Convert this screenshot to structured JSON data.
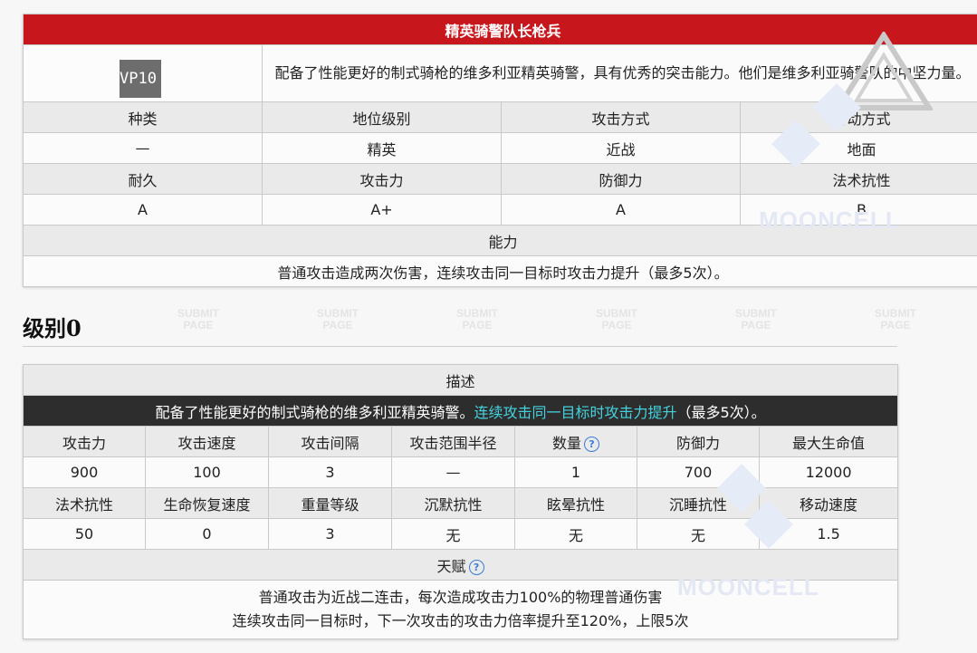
{
  "enemy": {
    "title": "精英骑警队长枪兵",
    "icon_text": "VP10",
    "description": "配备了性能更好的制式骑枪的维多利亚精英骑警，具有优秀的突击能力。他们是维多利亚骑警队的中坚力量。",
    "headers1": [
      "种类",
      "地位级别",
      "攻击方式",
      "行动方式"
    ],
    "values1": [
      "—",
      "精英",
      "近战",
      "地面"
    ],
    "headers2": [
      "耐久",
      "攻击力",
      "防御力",
      "法术抗性"
    ],
    "values2": [
      "A",
      "A+",
      "A",
      "B"
    ],
    "ability_label": "能力",
    "ability_text": "普通攻击造成两次伤害，连续攻击同一目标时攻击力提升（最多5次）。"
  },
  "level": {
    "heading": "级别0",
    "desc_label": "描述",
    "desc_main": "配备了性能更好的制式骑枪的维多利亚精英骑警。",
    "desc_highlight": "连续攻击同一目标时攻击力提升",
    "desc_tail": "（最多5次）。",
    "help_glyph": "?",
    "stat_headers1": [
      "攻击力",
      "攻击速度",
      "攻击间隔",
      "攻击范围半径",
      "数量",
      "防御力",
      "最大生命值"
    ],
    "stat_values1": [
      "900",
      "100",
      "3",
      "—",
      "1",
      "700",
      "12000"
    ],
    "stat_headers2": [
      "法术抗性",
      "生命恢复速度",
      "重量等级",
      "沉默抗性",
      "眩晕抗性",
      "沉睡抗性",
      "移动速度"
    ],
    "stat_values2": [
      "50",
      "0",
      "3",
      "无",
      "无",
      "无",
      "1.5"
    ],
    "talent_label": "天赋",
    "talent_line1": "普通攻击为近战二连击，每次造成攻击力100%的物理普通伤害",
    "talent_line2": "连续攻击同一目标时，下一次攻击的攻击力倍率提升至120%，上限5次"
  },
  "watermark": {
    "submit_line1": "SUBMIT",
    "submit_line2": "PAGE",
    "brand": "MOONCELL"
  }
}
